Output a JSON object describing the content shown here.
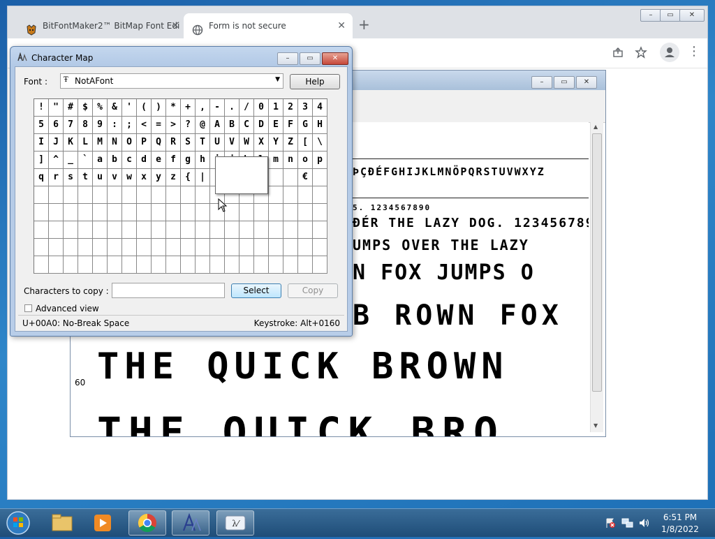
{
  "browser": {
    "tabs": [
      {
        "label": "BitFontMaker2™ BitMap Font Edi"
      },
      {
        "label": "Form is not secure"
      }
    ],
    "new_tab_symbol": "+",
    "close_symbol": "✕",
    "window_controls": [
      "–",
      "▭",
      "✕"
    ]
  },
  "bitfont_window": {
    "row_number": "60",
    "sample_lines": [
      "ÞÇÐÉFGHIJKLMNÖPQRSTUVWXYZ",
      "5. 1234567890",
      "ÐÉR THE LAZY DOG. 1234567890",
      "UMPS OVER THE LAZY",
      "N FOX JUMPS O",
      "B ROWN FOX",
      "THE QUICK BROWN",
      "THE QUICK BRO"
    ]
  },
  "charmap": {
    "title": "Character Map",
    "font_label": "Font :",
    "font_value": "NotAFont",
    "help_button": "Help",
    "chars_to_copy_label": "Characters to copy :",
    "chars_to_copy_value": "",
    "select_button": "Select",
    "copy_button": "Copy",
    "advanced_view_label": "Advanced view",
    "advanced_view_checked": false,
    "status_left": "U+00A0: No-Break Space",
    "status_right": "Keystroke: Alt+0160",
    "grid_rows": [
      [
        "!",
        "\"",
        "#",
        "$",
        "%",
        "&",
        "'",
        "(",
        ")",
        "*",
        "+",
        ",",
        "-",
        ".",
        "/",
        "0",
        "1",
        "2",
        "3",
        "4"
      ],
      [
        "5",
        "6",
        "7",
        "8",
        "9",
        ":",
        ";",
        "<",
        "=",
        ">",
        "?",
        "@",
        "A",
        "B",
        "C",
        "D",
        "E",
        "F",
        "G",
        "H"
      ],
      [
        "I",
        "J",
        "K",
        "L",
        "M",
        "N",
        "O",
        "P",
        "Q",
        "R",
        "S",
        "T",
        "U",
        "V",
        "W",
        "X",
        "Y",
        "Z",
        "[",
        "\\"
      ],
      [
        "]",
        "^",
        "_",
        "`",
        "a",
        "b",
        "c",
        "d",
        "e",
        "f",
        "g",
        "h",
        "i",
        "j",
        "k",
        "l",
        "m",
        "n",
        "o",
        "p"
      ],
      [
        "q",
        "r",
        "s",
        "t",
        "u",
        "v",
        "w",
        "x",
        "y",
        "z",
        "{",
        "|",
        "}",
        "~",
        "",
        "",
        "",
        "",
        "€",
        ""
      ],
      [
        "",
        "",
        "",
        "",
        "",
        "",
        "",
        "",
        "",
        "",
        "",
        "",
        "",
        "",
        "",
        "",
        "",
        "",
        "",
        ""
      ],
      [
        "",
        "",
        "",
        "",
        "",
        "",
        "",
        "",
        "",
        "",
        "",
        "",
        "",
        "",
        "",
        "",
        "",
        "",
        "",
        ""
      ],
      [
        "",
        "",
        "",
        "",
        "",
        "",
        "",
        "",
        "",
        "",
        "",
        "",
        "",
        "",
        "",
        "",
        "",
        "",
        "",
        ""
      ],
      [
        "",
        "",
        "",
        "",
        "",
        "",
        "",
        "",
        "",
        "",
        "",
        "",
        "",
        "",
        "",
        "",
        "",
        "",
        "",
        ""
      ],
      [
        "",
        "",
        "",
        "",
        "",
        "",
        "",
        "",
        "",
        "",
        "",
        "",
        "",
        "",
        "",
        "",
        "",
        "",
        "",
        ""
      ]
    ],
    "extra_glyph": "€"
  },
  "taskbar": {
    "items": [
      {
        "name": "start-orb"
      },
      {
        "name": "explorer"
      },
      {
        "name": "media-player"
      },
      {
        "name": "chrome"
      },
      {
        "name": "charmap"
      },
      {
        "name": "fontforge"
      }
    ],
    "time": "6:51 PM",
    "date": "1/8/2022"
  }
}
